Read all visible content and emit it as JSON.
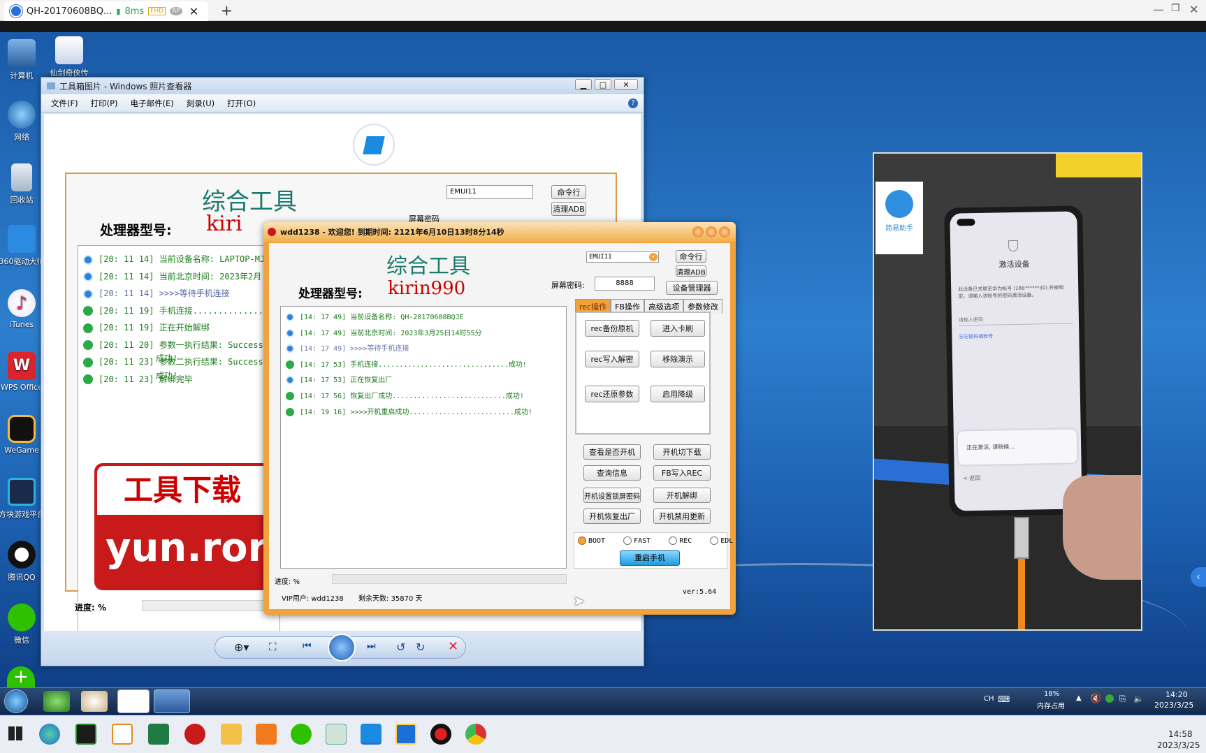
{
  "host": {
    "tab_title": "QH-20170608BQ...",
    "ping": "8ms",
    "badge_fhd": "FHD",
    "badge_rp": "RP",
    "new_tab": "+",
    "clock_time": "14:58",
    "clock_date": "2023/3/25"
  },
  "desktop": {
    "icons": [
      "计算机",
      "仙剑奇侠传",
      "网络",
      "回收站",
      "360驱动大师",
      "iTunes",
      "WPS Office",
      "WeGame",
      "方块游戏平台",
      "腾讯QQ",
      "微信"
    ]
  },
  "viewer": {
    "title": "工具箱图片 - Windows 照片查看器",
    "menu": [
      "文件(F)",
      "打印(P)",
      "电子邮件(E)",
      "刻录(U)",
      "打开(O)"
    ],
    "help": "?",
    "image": {
      "title": "综合工具",
      "cpu_label": "处理器型号:",
      "cpu_value": "kiri",
      "dropdown": "EMUI11",
      "btn_cmd": "命令行",
      "btn_clear": "清理ADB",
      "partial_label": "屏幕密码",
      "logs": [
        "[20: 11 14]  当前设备名称: LAPTOP-MJ",
        "[20: 11 14]  当前北京时间: 2023年2月",
        "[20: 11 14]  >>>>等待手机连接",
        "[20: 11 19]  手机连接..............",
        "[20: 11 19]  正在开始解绑",
        "[20: 11 20]  参数一执行结果: Success",
        "[20: 11 23]  参数二执行结果: Success",
        "[20: 11 23]  解绑完毕"
      ],
      "log_extra": [
        "成功!",
        "成功!"
      ],
      "banner_top": "工具下载",
      "banner_bottom": "yun.ror",
      "progress": "进度: %"
    }
  },
  "tool": {
    "title": "wdd1238 - 欢迎您! 到期时间: 2121年6月10日13时8分14秒",
    "heading": "综合工具",
    "dropdown": "EMUI11",
    "btn_cmd": "命令行",
    "btn_clear": "清理ADB",
    "cpu_label": "处理器型号:",
    "cpu_value": "kirin990",
    "pwd_label": "屏幕密码:",
    "pwd_value": "8888",
    "btn_devmgr": "设备管理器",
    "tabs": [
      "rec操作",
      "FB操作",
      "高级选项",
      "参数修改"
    ],
    "rec_buttons": [
      "rec备份原机",
      "进入卡刷",
      "rec写入解密",
      "移除演示",
      "rec还原参数",
      "启用降级"
    ],
    "lower_buttons": [
      "查看是否开机",
      "开机切下载",
      "查询信息",
      "FB写入REC",
      "开机设置锁屏密码",
      "开机解绑",
      "开机恢复出厂",
      "开机禁用更新"
    ],
    "radios": [
      "BOOT",
      "FAST",
      "REC",
      "EDL"
    ],
    "reboot": "重启手机",
    "logs": [
      {
        "t": "[14: 17 49]",
        "m": "当前设备名称: QH-20170608BQJE",
        "icon": "b"
      },
      {
        "t": "[14: 17 49]",
        "m": "当前北京时间: 2023年3月25日14时55分",
        "icon": "b"
      },
      {
        "t": "[14: 17 49]",
        "m": ">>>>等待手机连接",
        "icon": "b"
      },
      {
        "t": "[14: 17 53]",
        "m": "手机连接...............................成功!",
        "icon": "g"
      },
      {
        "t": "[14: 17 53]",
        "m": "正在恢复出厂",
        "icon": "b"
      },
      {
        "t": "[14: 17 56]",
        "m": "恢复出厂成功...........................成功!",
        "icon": "g"
      },
      {
        "t": "[14: 19 16]",
        "m": ">>>>开机重启成功.........................成功!",
        "icon": "g"
      }
    ],
    "progress": "进度: %",
    "vip": "VIP用户: wdd1238",
    "days": "剩余天数: 35870 天",
    "version": "ver:5.64"
  },
  "phone": {
    "heading": "激活设备",
    "desc": "此设备已关联至华为帐号 (186******30) 并被锁定。请输入该帐号的密码激活设备。",
    "pwd_hint": "请输入密码",
    "forgot": "忘记密码或帐号",
    "dialog": "正在激活, 请稍候...",
    "back": "< 返回",
    "logo_text": "简易助手"
  },
  "remote_taskbar": {
    "lang": "CH",
    "mem_pct": "18%",
    "mem_label": "内存占用",
    "time": "14:20",
    "date": "2023/3/25"
  }
}
